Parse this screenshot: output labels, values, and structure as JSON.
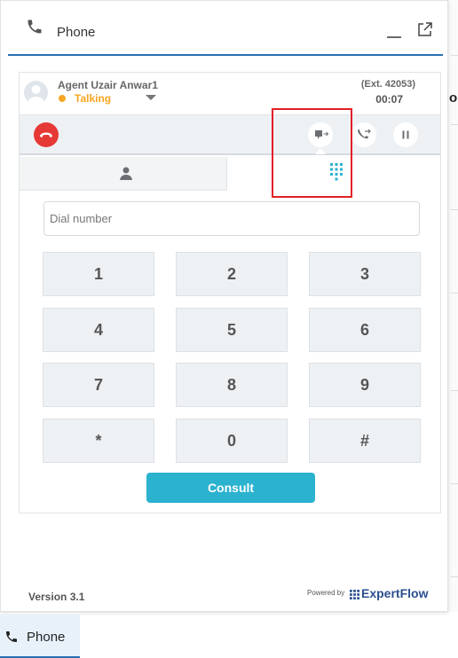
{
  "window": {
    "title": "Phone",
    "icons": {
      "title": "phone-icon",
      "minimize": "minimize-icon",
      "popout": "external-link-icon"
    }
  },
  "agent": {
    "name": "Agent Uzair Anwar1",
    "status": "Talking",
    "status_color": "#f6a623",
    "extension": "(Ext. 42053)",
    "call_timer": "00:07"
  },
  "call_controls": {
    "end_call_icon": "hang-up-icon",
    "transfer_icon": "transfer-call-icon",
    "consult_icon": "consult-call-icon",
    "hold_icon": "pause-icon",
    "end_call_color": "#e53935"
  },
  "tabs": [
    {
      "icon": "person-icon",
      "active": false
    },
    {
      "icon": "dialpad-icon",
      "active": true
    }
  ],
  "dialpad": {
    "placeholder": "Dial number",
    "keys": [
      "1",
      "2",
      "3",
      "4",
      "5",
      "6",
      "7",
      "8",
      "9",
      "*",
      "0",
      "#"
    ],
    "consult_label": "Consult",
    "accent": "#2bb2cf"
  },
  "footer": {
    "version": "Version 3.1",
    "powered_by": "Powered by",
    "brand": "ExpertFlow"
  },
  "taskbar": {
    "label": "Phone",
    "icon": "phone-icon"
  },
  "background": {
    "letter": "o"
  }
}
